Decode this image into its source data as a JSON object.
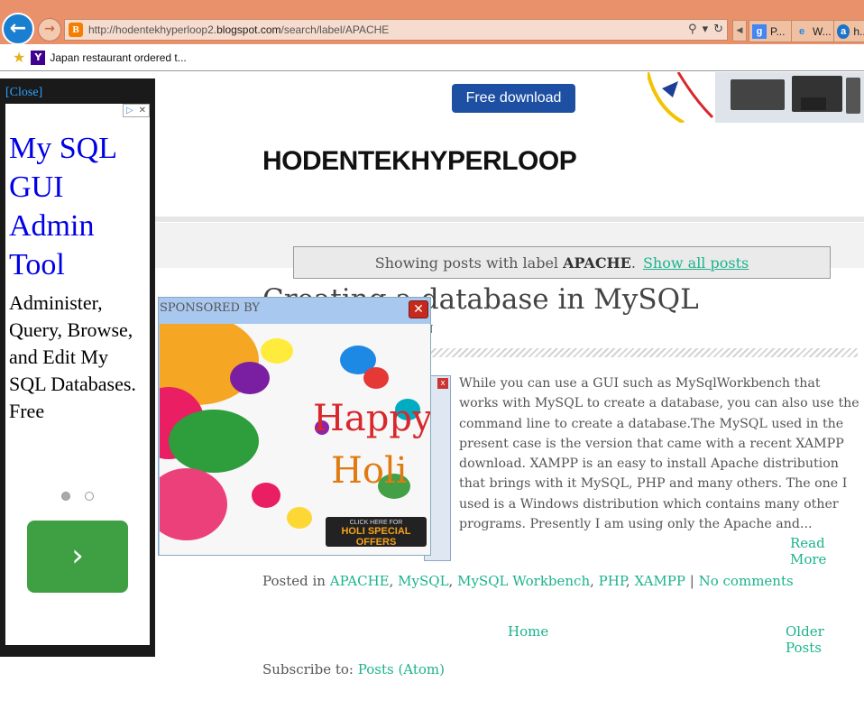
{
  "browser": {
    "url_prefix": "http://hodentekhyperloop2.",
    "url_domain": "blogspot.com",
    "url_path": "/search/label/APACHE",
    "tabs": [
      {
        "label": "P...",
        "icon": "google-icon"
      },
      {
        "label": "W...",
        "icon": "ie-icon"
      },
      {
        "label": "h...",
        "icon": "ask-icon"
      }
    ],
    "favorites": [
      {
        "label": "Japan restaurant ordered t...",
        "icon": "yahoo-icon"
      }
    ]
  },
  "header": {
    "ad_button": "Free download",
    "blog_title": "HODENTEKHYPERLOOP"
  },
  "status": {
    "text": "Showing posts with label ",
    "label": "APACHE",
    "suffix": ".",
    "link": "Show all posts"
  },
  "post": {
    "title": "Creating a database in MySQL",
    "meta_fragment": "N",
    "body": "While you can use a GUI such as MySqlWorkbench that works with MySQL to create a database, you can also use the command line to create a database.The MySQL used in the present case is the version that came with a recent XAMPP download. XAMPP is an easy to install Apache distribution that brings with it MySQL, PHP and many others. The one I used is a Windows distribution which contains many other programs. Presently I am using only the Apache and...",
    "read_more": "Read More",
    "posted_in_label": "Posted in",
    "labels": [
      "APACHE",
      "MySQL",
      "MySQL Workbench",
      "PHP",
      "XAMPP"
    ],
    "separator": "|",
    "comments": "No comments"
  },
  "pager": {
    "home": "Home",
    "older": "Older Posts"
  },
  "subscribe": {
    "label": "Subscribe to:",
    "link": "Posts (Atom)"
  },
  "left_ad": {
    "close": "[Close]",
    "headline": "My SQL GUI Admin Tool",
    "description": "Administer, Query, Browse, and Edit My SQL Databases. Free",
    "go_icon": "chevron-right-icon"
  },
  "popup": {
    "label": "SPONSORED BY",
    "image_text_line1": "Happy",
    "image_text_line2": "Holi",
    "cta_small": "CLICK HERE FOR",
    "cta_big": "HOLI SPECIAL OFFERS"
  }
}
